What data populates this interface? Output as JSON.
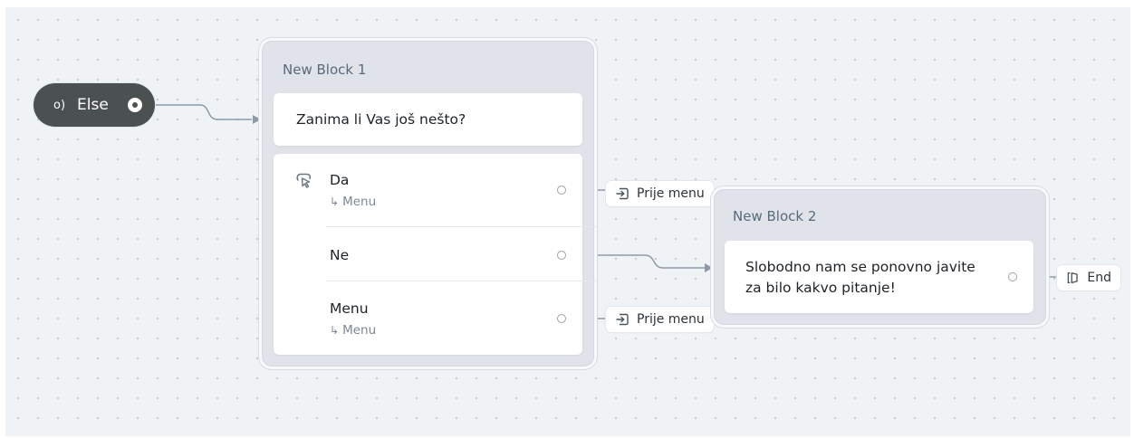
{
  "start": {
    "label": "Else",
    "icon": "signal-icon"
  },
  "block1": {
    "title": "New Block 1",
    "question": "Zanima li Vas još nešto?",
    "choices": [
      {
        "label": "Da",
        "sub": "Menu"
      },
      {
        "label": "Ne"
      },
      {
        "label": "Menu",
        "sub": "Menu"
      }
    ],
    "choice_icon": "pointer-select-icon"
  },
  "block2": {
    "title": "New Block 2",
    "message_line1": "Slobodno nam se ponovno javite",
    "message_line2": "za bilo kakvo pitanje!"
  },
  "jumps": [
    {
      "label": "Prije menu",
      "icon": "jump-to-icon"
    },
    {
      "label": "Prije menu",
      "icon": "jump-to-icon"
    }
  ],
  "end": {
    "label": "End",
    "icon": "end-flag-icon"
  },
  "colors": {
    "canvas": "#f0f3f5",
    "dot": "#c3cad1",
    "block_bg": "#e0e4ea",
    "block_title": "#586a7b",
    "start_node": "#4b5051",
    "wire": "#8c9aa7"
  }
}
